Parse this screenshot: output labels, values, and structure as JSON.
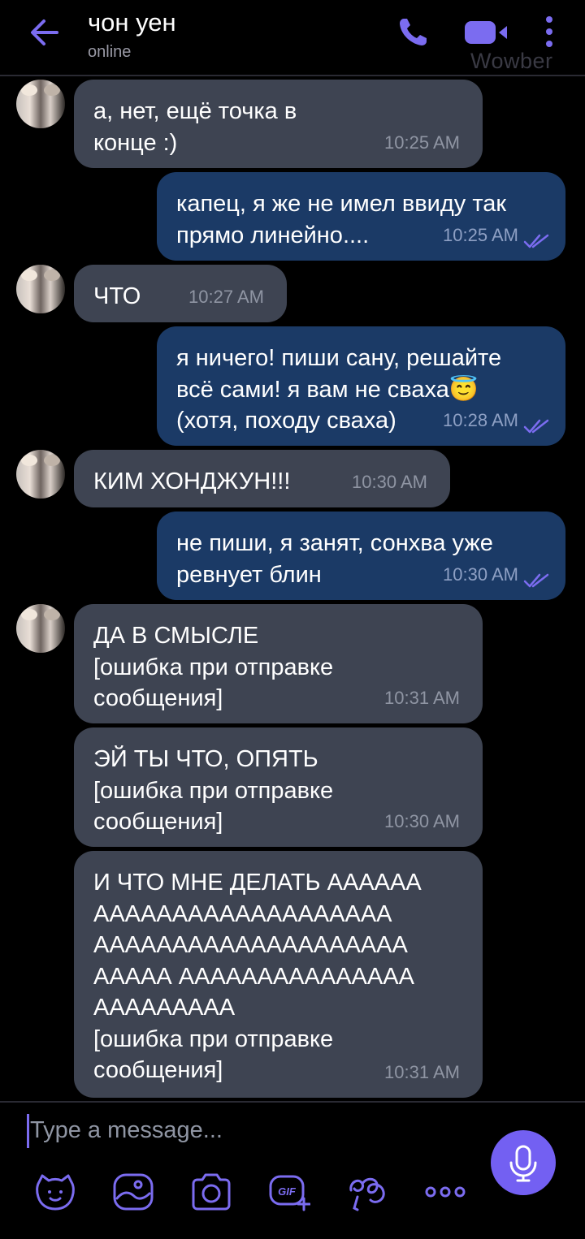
{
  "header": {
    "contact_name": "чон уен",
    "status": "online",
    "watermark": "Wowber",
    "icons": [
      "back-arrow-icon",
      "phone-icon",
      "video-call-icon",
      "more-vertical-icon"
    ],
    "accent_color": "#7360f2"
  },
  "messages": [
    {
      "direction": "incoming",
      "text": "а, нет, ещё точка в\nконце :)",
      "time": "10:25 AM",
      "has_avatar": true
    },
    {
      "direction": "outgoing",
      "text": "капец, я же не имел ввиду так\nпрямо линейно....",
      "time": "10:25 AM",
      "read": true
    },
    {
      "direction": "incoming",
      "text": "ЧТО",
      "time": "10:27 AM",
      "has_avatar": true
    },
    {
      "direction": "outgoing",
      "text": "я ничего! пиши сану, решайте\nвсё сами! я вам не сваха😇\n(хотя, походу сваха)",
      "time": "10:28 AM",
      "read": true
    },
    {
      "direction": "incoming",
      "text": "КИМ ХОНДЖУН!!!",
      "time": "10:30 AM",
      "has_avatar": true
    },
    {
      "direction": "outgoing",
      "text": "не пиши, я занят, сонхва уже\nревнует блин",
      "time": "10:30 AM",
      "read": true
    },
    {
      "direction": "incoming",
      "text": "ДА В СМЫСЛЕ\n[ошибка при отправке\nсообщения]",
      "time": "10:31 AM",
      "has_avatar": true
    },
    {
      "direction": "incoming",
      "text": "ЭЙ ТЫ ЧТО, ОПЯТЬ\n[ошибка при отправке\nсообщения]",
      "time": "10:30 AM",
      "has_avatar": false
    },
    {
      "direction": "incoming",
      "text": "И ЧТО МНЕ ДЕЛАТЬ АААААА\nААААААААААААААААААА\nАААААААААААААААААААА\nААААА ААААААААААААААА\nААААААААА\n[ошибка при отправке\nсообщения]",
      "time": "10:31 AM",
      "has_avatar": false
    }
  ],
  "composer": {
    "placeholder": "Type a message...",
    "tools": [
      "sticker-icon",
      "gallery-icon",
      "camera-icon",
      "gif-icon",
      "doodle-icon",
      "more-options-icon"
    ],
    "send_icon": "microphone-icon"
  }
}
